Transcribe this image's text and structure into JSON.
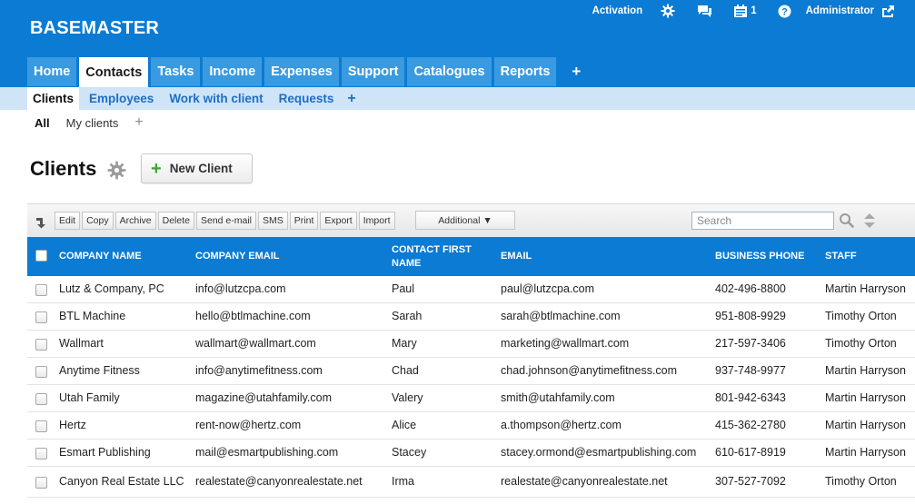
{
  "app": {
    "title": "BASEMASTER"
  },
  "topnav": {
    "activation": "Activation",
    "tasks_count": "1",
    "user": "Administrator"
  },
  "main_tabs": [
    {
      "label": "Home"
    },
    {
      "label": "Contacts"
    },
    {
      "label": "Tasks"
    },
    {
      "label": "Income"
    },
    {
      "label": "Expenses"
    },
    {
      "label": "Support"
    },
    {
      "label": "Catalogues"
    },
    {
      "label": "Reports"
    }
  ],
  "main_tabs_add": "+",
  "sub_tabs": [
    {
      "label": "Clients"
    },
    {
      "label": "Employees"
    },
    {
      "label": "Work with client"
    },
    {
      "label": "Requests"
    }
  ],
  "sub_tabs_add": "+",
  "filters": [
    {
      "label": "All"
    },
    {
      "label": "My clients"
    }
  ],
  "filters_add": "+",
  "page": {
    "title": "Clients",
    "new_button": "New Client"
  },
  "toolbar": {
    "buttons": [
      "Edit",
      "Copy",
      "Archive",
      "Delete",
      "Send e-mail",
      "SMS",
      "Print",
      "Export",
      "Import"
    ],
    "additional": "Additional ▼",
    "search_placeholder": "Search"
  },
  "table": {
    "columns": [
      "COMPANY NAME",
      "COMPANY EMAIL",
      "CONTACT FIRST NAME",
      "EMAIL",
      "BUSINESS PHONE",
      "STAFF"
    ],
    "rows": [
      [
        "Lutz & Company, PC",
        "info@lutzcpa.com",
        "Paul",
        "paul@lutzcpa.com",
        "402-496-8800",
        "Martin Harryson"
      ],
      [
        "BTL Machine",
        "hello@btlmachine.com",
        "Sarah",
        "sarah@btlmachine.com",
        "951-808-9929",
        "Timothy Orton"
      ],
      [
        "Wallmart",
        "wallmart@wallmart.com",
        "Mary",
        "marketing@wallmart.com",
        "217-597-3406",
        "Timothy Orton"
      ],
      [
        "Anytime Fitness",
        "info@anytimefitness.com",
        "Chad",
        "chad.johnson@anytimefitness.com",
        "937-748-9977",
        "Martin Harryson"
      ],
      [
        "Utah Family",
        "magazine@utahfamily.com",
        "Valery",
        "smith@utahfamily.com",
        "801-942-6343",
        "Martin Harryson"
      ],
      [
        "Hertz",
        "rent-now@hertz.com",
        "Alice",
        "a.thompson@hertz.com",
        "415-362-2780",
        "Martin Harryson"
      ],
      [
        "Esmart Publishing",
        "mail@esmartpublishing.com",
        "Stacey",
        "stacey.ormond@esmartpublishing.com",
        "610-617-8919",
        "Martin Harryson"
      ],
      [
        "Canyon Real Estate LLC",
        "realestate@canyonrealestate.net",
        "Irma",
        "realestate@canyonrealestate.net",
        "307-527-7092",
        "Timothy Orton"
      ]
    ]
  },
  "colors": {
    "header_blue": "#0b7bd3",
    "tab_blue": "#3a9ae0",
    "subtab_bg": "#cfe4f6",
    "link_blue": "#1d6fc6",
    "new_plus_green": "#3aa537"
  }
}
